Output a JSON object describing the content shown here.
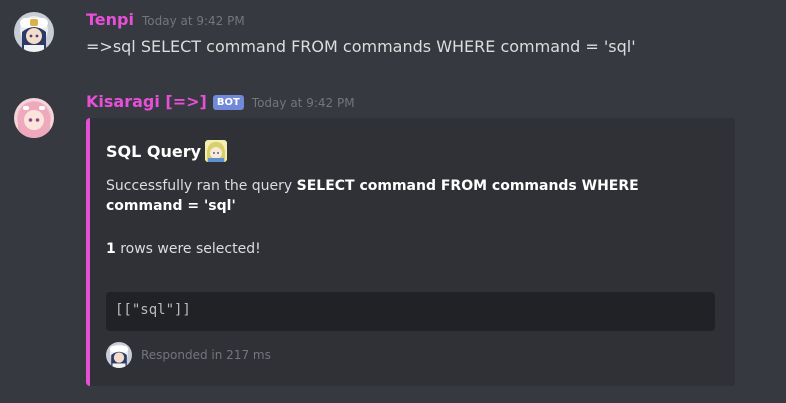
{
  "messages": [
    {
      "username": "Tenpi",
      "timestamp": "Today at 9:42 PM",
      "content": "=>sql SELECT command FROM commands WHERE command = 'sql'"
    },
    {
      "username": "Kisaragi [=>]",
      "bot_tag": "BOT",
      "timestamp": "Today at 9:42 PM",
      "embed": {
        "title": "SQL Query",
        "description_prefix": "Successfully ran the query ",
        "description_query": "SELECT command FROM commands WHERE command = 'sql'",
        "rows_count": "1",
        "rows_suffix": " rows were selected!",
        "code": "[[\"sql\"]]",
        "footer": "Responded in 217 ms",
        "accent_color": "#e84fd9"
      }
    }
  ],
  "colors": {
    "background": "#36393f",
    "embed_background": "#2f3136",
    "username": "#e84fd9",
    "bot_tag": "#7289da",
    "timestamp": "#72767d"
  }
}
